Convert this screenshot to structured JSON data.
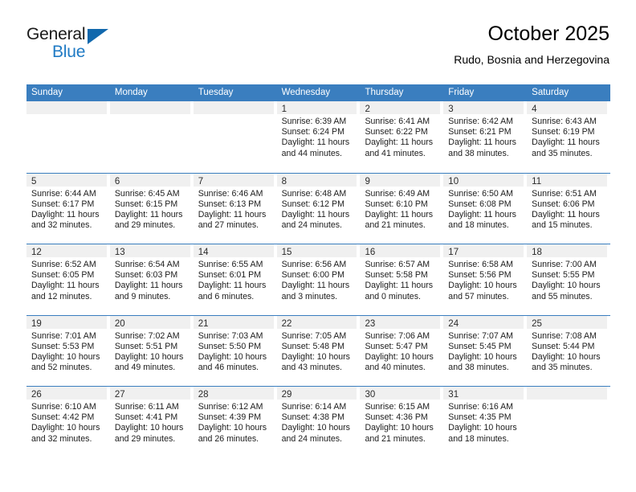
{
  "brand": {
    "line1": "General",
    "line2": "Blue",
    "triangle_color": "#1168ad"
  },
  "header": {
    "title": "October 2025",
    "subtitle": "Rudo, Bosnia and Herzegovina"
  },
  "theme": {
    "header_row_color": "#3a7ebf",
    "day_band_color": "#f0f0f0",
    "text_color": "#1c1c1c"
  },
  "calendar": {
    "weekdays": [
      "Sunday",
      "Monday",
      "Tuesday",
      "Wednesday",
      "Thursday",
      "Friday",
      "Saturday"
    ],
    "weeks": [
      [
        {
          "day": "",
          "empty": true
        },
        {
          "day": "",
          "empty": true
        },
        {
          "day": "",
          "empty": true
        },
        {
          "day": "1",
          "sunrise": "Sunrise: 6:39 AM",
          "sunset": "Sunset: 6:24 PM",
          "daylight_line1": "Daylight: 11 hours",
          "daylight_line2": "and 44 minutes."
        },
        {
          "day": "2",
          "sunrise": "Sunrise: 6:41 AM",
          "sunset": "Sunset: 6:22 PM",
          "daylight_line1": "Daylight: 11 hours",
          "daylight_line2": "and 41 minutes."
        },
        {
          "day": "3",
          "sunrise": "Sunrise: 6:42 AM",
          "sunset": "Sunset: 6:21 PM",
          "daylight_line1": "Daylight: 11 hours",
          "daylight_line2": "and 38 minutes."
        },
        {
          "day": "4",
          "sunrise": "Sunrise: 6:43 AM",
          "sunset": "Sunset: 6:19 PM",
          "daylight_line1": "Daylight: 11 hours",
          "daylight_line2": "and 35 minutes."
        }
      ],
      [
        {
          "day": "5",
          "sunrise": "Sunrise: 6:44 AM",
          "sunset": "Sunset: 6:17 PM",
          "daylight_line1": "Daylight: 11 hours",
          "daylight_line2": "and 32 minutes."
        },
        {
          "day": "6",
          "sunrise": "Sunrise: 6:45 AM",
          "sunset": "Sunset: 6:15 PM",
          "daylight_line1": "Daylight: 11 hours",
          "daylight_line2": "and 29 minutes."
        },
        {
          "day": "7",
          "sunrise": "Sunrise: 6:46 AM",
          "sunset": "Sunset: 6:13 PM",
          "daylight_line1": "Daylight: 11 hours",
          "daylight_line2": "and 27 minutes."
        },
        {
          "day": "8",
          "sunrise": "Sunrise: 6:48 AM",
          "sunset": "Sunset: 6:12 PM",
          "daylight_line1": "Daylight: 11 hours",
          "daylight_line2": "and 24 minutes."
        },
        {
          "day": "9",
          "sunrise": "Sunrise: 6:49 AM",
          "sunset": "Sunset: 6:10 PM",
          "daylight_line1": "Daylight: 11 hours",
          "daylight_line2": "and 21 minutes."
        },
        {
          "day": "10",
          "sunrise": "Sunrise: 6:50 AM",
          "sunset": "Sunset: 6:08 PM",
          "daylight_line1": "Daylight: 11 hours",
          "daylight_line2": "and 18 minutes."
        },
        {
          "day": "11",
          "sunrise": "Sunrise: 6:51 AM",
          "sunset": "Sunset: 6:06 PM",
          "daylight_line1": "Daylight: 11 hours",
          "daylight_line2": "and 15 minutes."
        }
      ],
      [
        {
          "day": "12",
          "sunrise": "Sunrise: 6:52 AM",
          "sunset": "Sunset: 6:05 PM",
          "daylight_line1": "Daylight: 11 hours",
          "daylight_line2": "and 12 minutes."
        },
        {
          "day": "13",
          "sunrise": "Sunrise: 6:54 AM",
          "sunset": "Sunset: 6:03 PM",
          "daylight_line1": "Daylight: 11 hours",
          "daylight_line2": "and 9 minutes."
        },
        {
          "day": "14",
          "sunrise": "Sunrise: 6:55 AM",
          "sunset": "Sunset: 6:01 PM",
          "daylight_line1": "Daylight: 11 hours",
          "daylight_line2": "and 6 minutes."
        },
        {
          "day": "15",
          "sunrise": "Sunrise: 6:56 AM",
          "sunset": "Sunset: 6:00 PM",
          "daylight_line1": "Daylight: 11 hours",
          "daylight_line2": "and 3 minutes."
        },
        {
          "day": "16",
          "sunrise": "Sunrise: 6:57 AM",
          "sunset": "Sunset: 5:58 PM",
          "daylight_line1": "Daylight: 11 hours",
          "daylight_line2": "and 0 minutes."
        },
        {
          "day": "17",
          "sunrise": "Sunrise: 6:58 AM",
          "sunset": "Sunset: 5:56 PM",
          "daylight_line1": "Daylight: 10 hours",
          "daylight_line2": "and 57 minutes."
        },
        {
          "day": "18",
          "sunrise": "Sunrise: 7:00 AM",
          "sunset": "Sunset: 5:55 PM",
          "daylight_line1": "Daylight: 10 hours",
          "daylight_line2": "and 55 minutes."
        }
      ],
      [
        {
          "day": "19",
          "sunrise": "Sunrise: 7:01 AM",
          "sunset": "Sunset: 5:53 PM",
          "daylight_line1": "Daylight: 10 hours",
          "daylight_line2": "and 52 minutes."
        },
        {
          "day": "20",
          "sunrise": "Sunrise: 7:02 AM",
          "sunset": "Sunset: 5:51 PM",
          "daylight_line1": "Daylight: 10 hours",
          "daylight_line2": "and 49 minutes."
        },
        {
          "day": "21",
          "sunrise": "Sunrise: 7:03 AM",
          "sunset": "Sunset: 5:50 PM",
          "daylight_line1": "Daylight: 10 hours",
          "daylight_line2": "and 46 minutes."
        },
        {
          "day": "22",
          "sunrise": "Sunrise: 7:05 AM",
          "sunset": "Sunset: 5:48 PM",
          "daylight_line1": "Daylight: 10 hours",
          "daylight_line2": "and 43 minutes."
        },
        {
          "day": "23",
          "sunrise": "Sunrise: 7:06 AM",
          "sunset": "Sunset: 5:47 PM",
          "daylight_line1": "Daylight: 10 hours",
          "daylight_line2": "and 40 minutes."
        },
        {
          "day": "24",
          "sunrise": "Sunrise: 7:07 AM",
          "sunset": "Sunset: 5:45 PM",
          "daylight_line1": "Daylight: 10 hours",
          "daylight_line2": "and 38 minutes."
        },
        {
          "day": "25",
          "sunrise": "Sunrise: 7:08 AM",
          "sunset": "Sunset: 5:44 PM",
          "daylight_line1": "Daylight: 10 hours",
          "daylight_line2": "and 35 minutes."
        }
      ],
      [
        {
          "day": "26",
          "sunrise": "Sunrise: 6:10 AM",
          "sunset": "Sunset: 4:42 PM",
          "daylight_line1": "Daylight: 10 hours",
          "daylight_line2": "and 32 minutes."
        },
        {
          "day": "27",
          "sunrise": "Sunrise: 6:11 AM",
          "sunset": "Sunset: 4:41 PM",
          "daylight_line1": "Daylight: 10 hours",
          "daylight_line2": "and 29 minutes."
        },
        {
          "day": "28",
          "sunrise": "Sunrise: 6:12 AM",
          "sunset": "Sunset: 4:39 PM",
          "daylight_line1": "Daylight: 10 hours",
          "daylight_line2": "and 26 minutes."
        },
        {
          "day": "29",
          "sunrise": "Sunrise: 6:14 AM",
          "sunset": "Sunset: 4:38 PM",
          "daylight_line1": "Daylight: 10 hours",
          "daylight_line2": "and 24 minutes."
        },
        {
          "day": "30",
          "sunrise": "Sunrise: 6:15 AM",
          "sunset": "Sunset: 4:36 PM",
          "daylight_line1": "Daylight: 10 hours",
          "daylight_line2": "and 21 minutes."
        },
        {
          "day": "31",
          "sunrise": "Sunrise: 6:16 AM",
          "sunset": "Sunset: 4:35 PM",
          "daylight_line1": "Daylight: 10 hours",
          "daylight_line2": "and 18 minutes."
        },
        {
          "day": "",
          "empty": true
        }
      ]
    ]
  }
}
